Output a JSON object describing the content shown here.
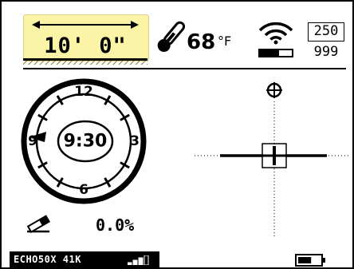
{
  "depth": {
    "value": "10' 0\""
  },
  "temperature": {
    "value": "68",
    "unit": "°F"
  },
  "signal": {
    "level": 0.6,
    "gain_top": "250",
    "gain_bottom": "999"
  },
  "clock": {
    "numbers": [
      "12",
      "3",
      "6",
      "9"
    ],
    "time": "9:30"
  },
  "pitch": {
    "value": "0.0%"
  },
  "status": {
    "text": "ECHO50X 41K",
    "signal_bars": 3
  },
  "battery": {
    "level": 0.6
  },
  "icons": [
    "depth-arrow-icon",
    "thermometer-icon",
    "wifi-icon",
    "pitch-icon",
    "signal-bars-icon",
    "battery-icon",
    "target-icon"
  ]
}
